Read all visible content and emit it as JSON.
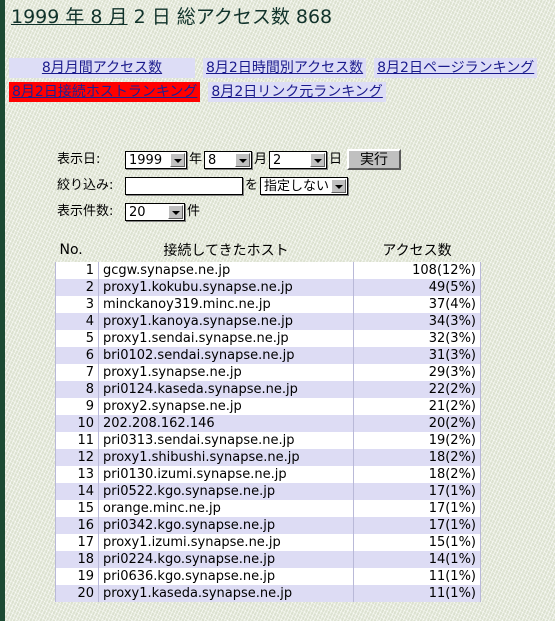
{
  "page": {
    "title_underlined": "1999 年 8 月",
    "title_rest": " 2 日  総アクセス数 868",
    "total_accesses": "868",
    "year": "1999",
    "month": "8",
    "day": "2"
  },
  "nav": {
    "rows": [
      [
        {
          "label": "8月月間アクセス数",
          "active": false,
          "wide": true
        },
        {
          "label": "8月2日時間別アクセス数",
          "active": false,
          "wide": false
        },
        {
          "label": "8月2日ページランキング",
          "active": false,
          "wide": false
        }
      ],
      [
        {
          "label": "8月2日接続ホストランキング",
          "active": true,
          "wide": false
        },
        {
          "label": "8月2日リンク元ランキング",
          "active": false,
          "wide": false
        }
      ]
    ]
  },
  "form": {
    "display_date_label": "表示日:",
    "year_value": "1999",
    "year_unit": "年",
    "month_value": "8",
    "month_unit": "月",
    "day_value": "2",
    "day_unit": "日",
    "submit_label": "実行",
    "filter_label": "絞り込み:",
    "filter_value": "",
    "filter_placeholder": "",
    "filter_particle": "を",
    "filter_mode_value": "指定しない",
    "count_label": "表示件数:",
    "count_value": "20",
    "count_unit": "件"
  },
  "table": {
    "headers": {
      "no": "No.",
      "host": "接続してきたホスト",
      "count": "アクセス数"
    },
    "rows": [
      {
        "no": "1",
        "host": "gcgw.synapse.ne.jp",
        "count": "108(12%)"
      },
      {
        "no": "2",
        "host": "proxy1.kokubu.synapse.ne.jp",
        "count": "49(5%)"
      },
      {
        "no": "3",
        "host": "minckanoy319.minc.ne.jp",
        "count": "37(4%)"
      },
      {
        "no": "4",
        "host": "proxy1.kanoya.synapse.ne.jp",
        "count": "34(3%)"
      },
      {
        "no": "5",
        "host": "proxy1.sendai.synapse.ne.jp",
        "count": "32(3%)"
      },
      {
        "no": "6",
        "host": "bri0102.sendai.synapse.ne.jp",
        "count": "31(3%)"
      },
      {
        "no": "7",
        "host": "proxy1.synapse.ne.jp",
        "count": "29(3%)"
      },
      {
        "no": "8",
        "host": "pri0124.kaseda.synapse.ne.jp",
        "count": "22(2%)"
      },
      {
        "no": "9",
        "host": "proxy2.synapse.ne.jp",
        "count": "21(2%)"
      },
      {
        "no": "10",
        "host": "202.208.162.146",
        "count": "20(2%)"
      },
      {
        "no": "11",
        "host": "pri0313.sendai.synapse.ne.jp",
        "count": "19(2%)"
      },
      {
        "no": "12",
        "host": "proxy1.shibushi.synapse.ne.jp",
        "count": "18(2%)"
      },
      {
        "no": "13",
        "host": "pri0130.izumi.synapse.ne.jp",
        "count": "18(2%)"
      },
      {
        "no": "14",
        "host": "pri0522.kgo.synapse.ne.jp",
        "count": "17(1%)"
      },
      {
        "no": "15",
        "host": "orange.minc.ne.jp",
        "count": "17(1%)"
      },
      {
        "no": "16",
        "host": "pri0342.kgo.synapse.ne.jp",
        "count": "17(1%)"
      },
      {
        "no": "17",
        "host": "proxy1.izumi.synapse.ne.jp",
        "count": "15(1%)"
      },
      {
        "no": "18",
        "host": "pri0224.kgo.synapse.ne.jp",
        "count": "14(1%)"
      },
      {
        "no": "19",
        "host": "pri0636.kgo.synapse.ne.jp",
        "count": "11(1%)"
      },
      {
        "no": "20",
        "host": "proxy1.kaseda.synapse.ne.jp",
        "count": "11(1%)"
      }
    ]
  },
  "colors": {
    "page_background": "#eef0e4",
    "left_border": "#1c4a33",
    "link_background": "#ddddf6",
    "link_text": "#1a1a8c",
    "active_link_background": "#ff0000",
    "row_alt_background": "#dddcf4",
    "row_background": "#ffffff"
  }
}
